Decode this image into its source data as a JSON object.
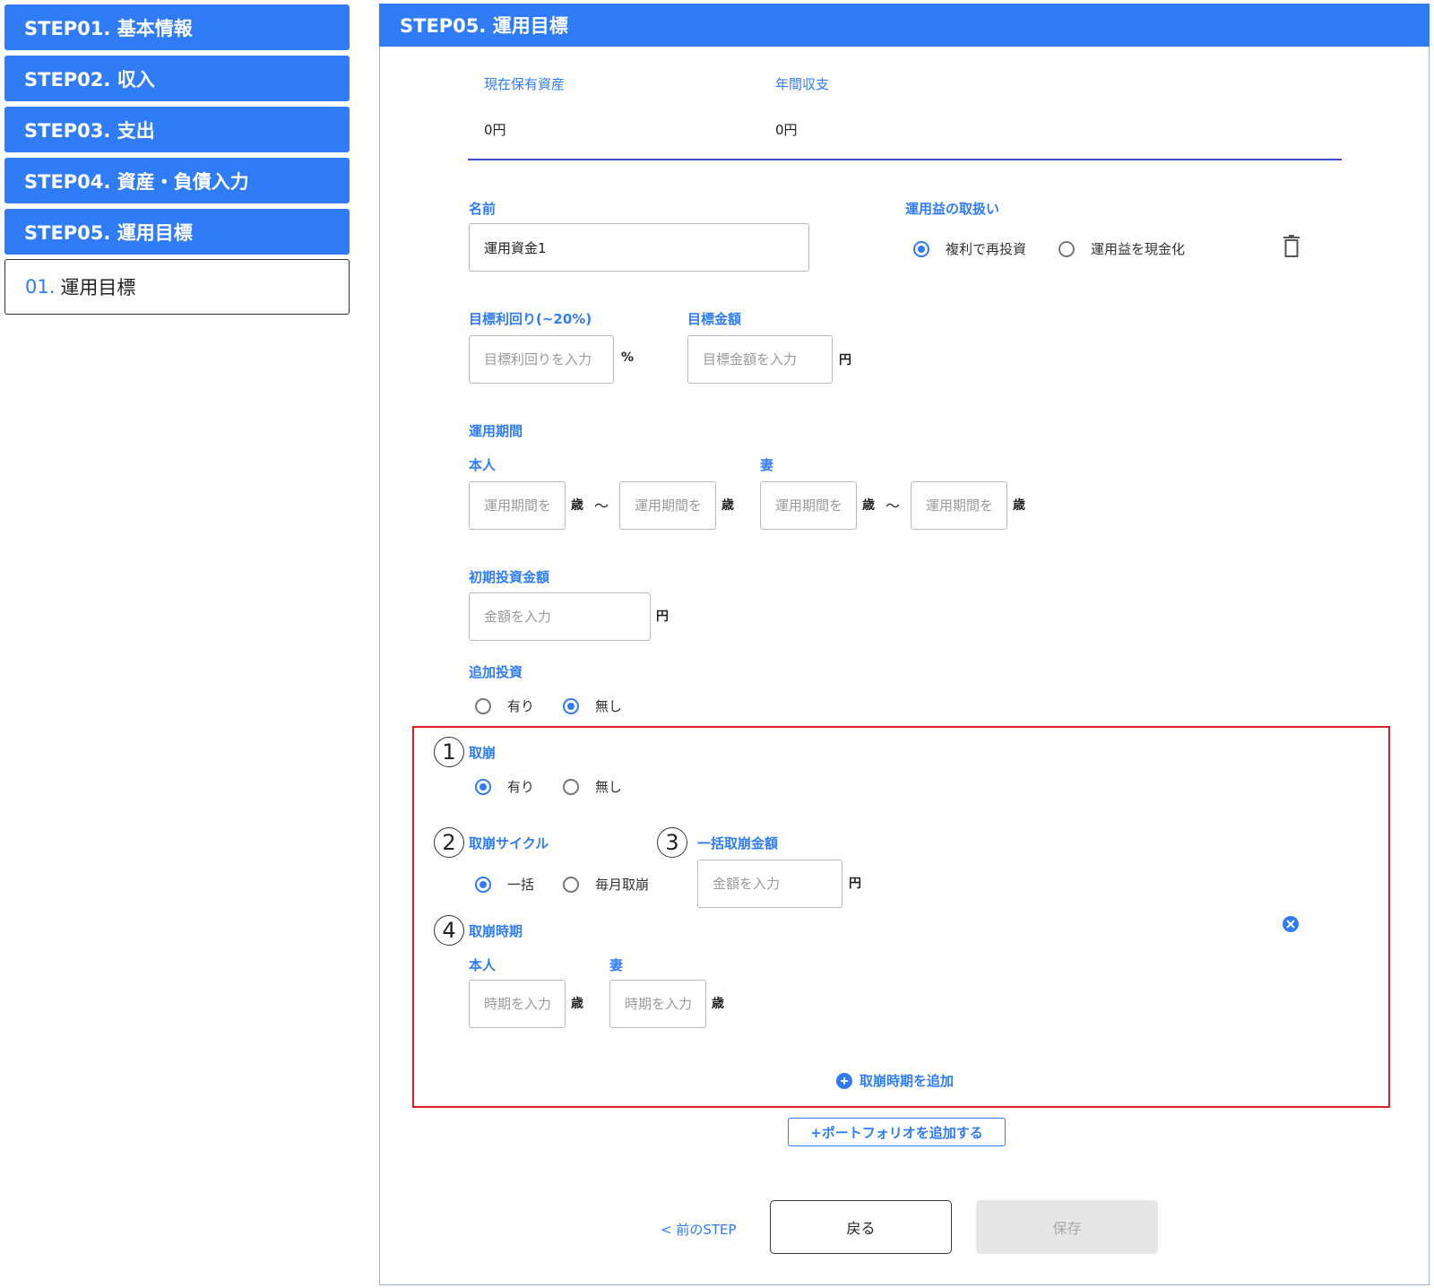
{
  "sidebar": {
    "steps": [
      "STEP01. 基本情報",
      "STEP02. 収入",
      "STEP03. 支出",
      "STEP04. 資産・負債入力",
      "STEP05. 運用目標"
    ],
    "sub": {
      "num": "01.",
      "label": "運用目標"
    }
  },
  "header": {
    "title": "STEP05. 運用目標"
  },
  "summary": {
    "assets_label": "現在保有資産",
    "assets_value": "0円",
    "balance_label": "年間収支",
    "balance_value": "0円"
  },
  "form": {
    "name_label": "名前",
    "name_value": "運用資金1",
    "profit_label": "運用益の取扱い",
    "profit_option_reinvest": "複利で再投資",
    "profit_option_cash": "運用益を現金化",
    "target_rate_label": "目標利回り(~20%)",
    "target_rate_placeholder": "目標利回りを入力",
    "percent_unit": "%",
    "target_amount_label": "目標金額",
    "target_amount_placeholder": "目標金額を入力",
    "yen_unit": "円",
    "period_label": "運用期間",
    "self_label": "本人",
    "wife_label": "妻",
    "period_placeholder": "運用期間を",
    "age_unit": "歳",
    "tilde": "〜",
    "initial_label": "初期投資金額",
    "amount_placeholder": "金額を入力",
    "add_invest_label": "追加投資",
    "yes": "有り",
    "no": "無し",
    "withdraw_label": "取崩",
    "cycle_label": "取崩サイクル",
    "cycle_lump": "一括",
    "cycle_monthly": "毎月取崩",
    "lump_amount_label": "一括取崩金額",
    "timing_label": "取崩時期",
    "timing_placeholder": "時期を入力",
    "add_timing": "取崩時期を追加",
    "num1": "1",
    "num2": "2",
    "num3": "3",
    "num4": "4"
  },
  "footer": {
    "add_portfolio": "+ポートフォリオを追加する",
    "prev_step": "< 前のSTEP",
    "back": "戻る",
    "save": "保存"
  },
  "colors": {
    "accent": "#2f7cf6",
    "highlight": "#e02020"
  }
}
